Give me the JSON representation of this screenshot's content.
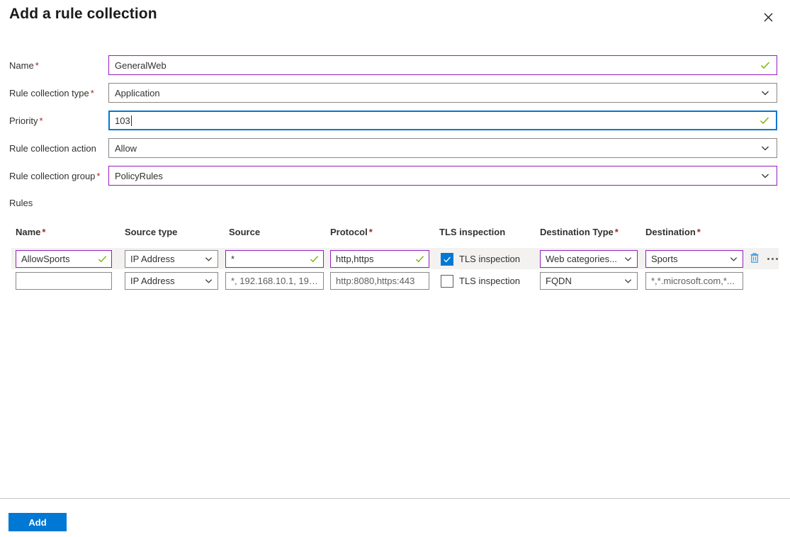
{
  "header": {
    "title": "Add a rule collection",
    "close_label": "Close"
  },
  "form": {
    "fields": [
      {
        "label": "Name",
        "required": true,
        "value": "GeneralWeb",
        "control": "text",
        "state": "valid",
        "border": "purple"
      },
      {
        "label": "Rule collection type",
        "required": true,
        "value": "Application",
        "control": "select",
        "state": "normal",
        "border": "gray"
      },
      {
        "label": "Priority",
        "required": true,
        "value": "103",
        "control": "text",
        "state": "valid",
        "border": "focused"
      },
      {
        "label": "Rule collection action",
        "required": false,
        "value": "Allow",
        "control": "select",
        "state": "normal",
        "border": "gray"
      },
      {
        "label": "Rule collection group",
        "required": true,
        "value": "PolicyRules",
        "control": "select",
        "state": "normal",
        "border": "purple"
      }
    ]
  },
  "rules": {
    "section_label": "Rules",
    "columns": [
      {
        "label": "Name",
        "required": true
      },
      {
        "label": "Source type",
        "required": false
      },
      {
        "label": "Source",
        "required": false
      },
      {
        "label": "Protocol",
        "required": true
      },
      {
        "label": "TLS inspection",
        "required": false
      },
      {
        "label": "Destination Type",
        "required": true
      },
      {
        "label": "Destination",
        "required": true
      }
    ],
    "rows": [
      {
        "shaded": true,
        "name": {
          "value": "AllowSports",
          "placeholder": "",
          "state": "valid",
          "border": "purple"
        },
        "source_type": {
          "value": "IP Address",
          "border": "gray"
        },
        "source": {
          "value": "*",
          "placeholder": "",
          "state": "valid",
          "border": "purple"
        },
        "protocol": {
          "value": "http,https",
          "placeholder": "",
          "state": "valid",
          "border": "purple"
        },
        "tls": {
          "label": "TLS inspection",
          "checked": true
        },
        "destination_type": {
          "value": "Web categories...",
          "border": "purple"
        },
        "destination": {
          "value": "Sports",
          "border": "purple"
        },
        "actions": {
          "delete_label": "Delete rule",
          "more_label": "More options"
        }
      },
      {
        "shaded": false,
        "name": {
          "value": "",
          "placeholder": "",
          "state": "none",
          "border": "gray"
        },
        "source_type": {
          "value": "IP Address",
          "border": "gray"
        },
        "source": {
          "value": "",
          "placeholder": "*, 192.168.10.1, 192...",
          "state": "none",
          "border": "gray"
        },
        "protocol": {
          "value": "",
          "placeholder": "http:8080,https:443",
          "state": "none",
          "border": "gray"
        },
        "tls": {
          "label": "TLS inspection",
          "checked": false
        },
        "destination_type": {
          "value": "FQDN",
          "border": "gray"
        },
        "destination": {
          "value": "",
          "placeholder": "*,*.microsoft.com,*...",
          "border": "gray"
        }
      }
    ]
  },
  "footer": {
    "add_label": "Add"
  },
  "colors": {
    "accent": "#0078d4",
    "purple_border": "#951bc0",
    "required_asterisk": "#a4262c",
    "valid_check": "#7ab800",
    "row_shade": "#f3f2f1",
    "gray_border": "#8a8886"
  }
}
